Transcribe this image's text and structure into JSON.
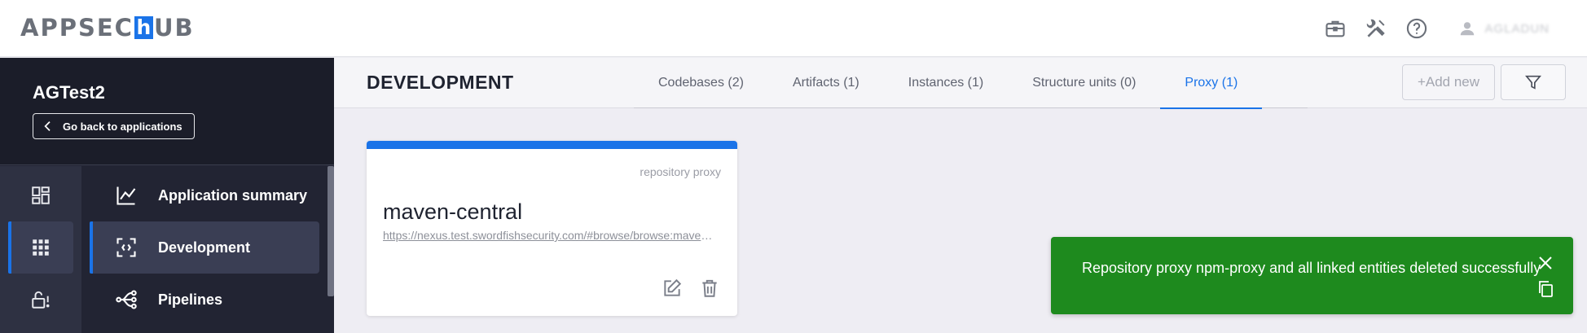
{
  "app": {
    "logo_text_before": "APPSEC",
    "logo_highlight": "h",
    "logo_text_after": "UB"
  },
  "topbar": {
    "icons": [
      "briefcase-icon",
      "tools-icon",
      "help-icon"
    ],
    "user_name": "AGLADUN"
  },
  "sidebar": {
    "project_name": "AGTest2",
    "back_label": "Go back to applications",
    "rail_items": [
      "dashboard-icon",
      "apps-grid-icon",
      "lock-alert-icon"
    ],
    "menu_items": [
      {
        "label": "Application summary",
        "icon": "chart-line-icon"
      },
      {
        "label": "Development",
        "icon": "code-scan-icon"
      },
      {
        "label": "Pipelines",
        "icon": "pipeline-icon"
      }
    ]
  },
  "header": {
    "title": "DEVELOPMENT",
    "tabs": [
      {
        "label": "Codebases (2)"
      },
      {
        "label": "Artifacts (1)"
      },
      {
        "label": "Instances (1)"
      },
      {
        "label": "Structure units (0)"
      },
      {
        "label": "Proxy (1)"
      }
    ],
    "active_tab": "Proxy (1)",
    "add_label": "+Add new"
  },
  "card": {
    "type": "repository proxy",
    "title": "maven-central",
    "link": "https://nexus.test.swordfishsecurity.com/#browse/browse:maven-central"
  },
  "toast": {
    "message": "Repository proxy npm-proxy and all linked entities deleted successfully"
  },
  "colors": {
    "accent": "#1a73e8",
    "sidebar_bg": "#222433",
    "toast_success": "#1e8a1e"
  }
}
